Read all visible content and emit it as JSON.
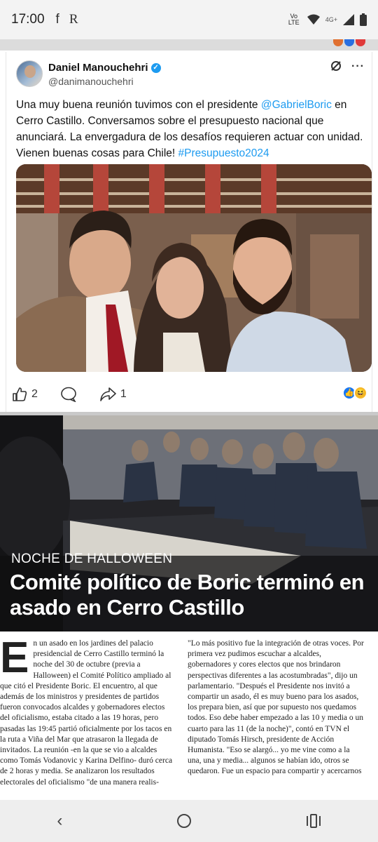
{
  "status": {
    "time": "17:00",
    "apps": [
      "f",
      "R"
    ],
    "network": "Vo LTE",
    "signal_label": "4G+"
  },
  "tweet": {
    "author": "Daniel Manouchehri",
    "handle": "@danimanouchehri",
    "text_before": "Una muy buena reunión tuvimos con el presidente ",
    "mention": "@GabrielBoric",
    "text_after": " en Cerro Castillo. Conversamos sobre el presupuesto nacional que anunciará.  La envergadura de los desafíos requieren actuar con unidad. Vienen buenas cosas para Chile! ",
    "hashtag": "#Presupuesto2024",
    "likes": "2",
    "shares": "1",
    "icons": [
      "like-icon",
      "comment-icon",
      "share-icon",
      "grok-icon",
      "more-icon"
    ],
    "colors": {
      "link": "#1d9bf0",
      "like": "#1877f2",
      "haha": "#f7b928"
    }
  },
  "news": {
    "kicker": "NOCHE DE HALLOWEEN",
    "headline": "Comité político de Boric terminó en asado en Cerro Castillo",
    "dropcap": "E",
    "col1": "n un asado en los jardines del palacio presidencial de Cerro Castillo terminó la noche del 30 de octubre (previa a Halloween) el Comité Político ampliado al que citó el Presidente Boric. El encuentro, al que además de los ministros y presidentes de partidos fueron convocados alcaldes y gobernadores electos del oficialismo, estaba citado a las 19 horas, pero pasadas las 19:45 partió oficialmente por los tacos en la ruta a Viña del Mar que atrasaron la llegada de invitados. La reunión -en la que se vio a alcaldes como Tomás Vodanovic y Karina Delfino- duró cerca de 2 horas y media. Se analizaron los resultados electorales del oficialismo \"de una manera realis-",
    "col2": "\"Lo más positivo fue la integración de otras voces. Por primera vez pudimos escuchar a alcaldes, gobernadores y cores electos que nos brindaron perspectivas diferentes a las acostumbradas\", dijo un parlamentario. \"Después el Presidente nos invitó a compartir un asado, él es muy bueno para los asados, los prepara bien, así que por supuesto nos quedamos todos. Eso debe haber empezado a las 10 y media o un cuarto para las 11 (de la noche)\", contó en TVN el diputado Tomás Hirsch, presidente de Acción Humanista. \"Eso se alargó... yo me vine como a la una, una y media... algunos se habían ido, otros se quedaron. Fue un espacio para compartir y acercarnos"
  },
  "nav": {
    "icons": [
      "back-icon",
      "home-icon",
      "recents-icon"
    ]
  }
}
